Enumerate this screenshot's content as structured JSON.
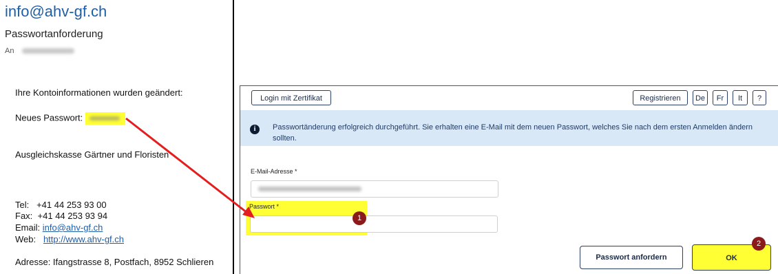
{
  "email": {
    "sender": "info@ahv-gf.ch",
    "subject": "Passwortanforderung",
    "to_label": "An",
    "body_intro": "Ihre Kontoinformationen wurden geändert:",
    "new_password_label": "Neues Passwort:",
    "org_name": "Ausgleichskasse Gärtner und Floristen",
    "tel_label": "Tel:",
    "tel": "+41 44 253 93 00",
    "fax_label": "Fax:",
    "fax": "+41 44 253 93 94",
    "email_label": "Email:",
    "email_link": "info@ahv-gf.ch",
    "web_label": "Web:",
    "web_link": "http://www.ahv-gf.ch",
    "address": "Adresse: Ifangstrasse 8, Postfach, 8952 Schlieren"
  },
  "form": {
    "login_cert": "Login mit Zertifikat",
    "register": "Registrieren",
    "languages": [
      "De",
      "Fr",
      "It"
    ],
    "help": "?",
    "info_icon": "info-icon",
    "info_message": "Passwortänderung erfolgreich durchgeführt. Sie erhalten eine E-Mail mit dem neuen Passwort, welches Sie nach dem ersten Anmelden ändern sollten.",
    "email_field_label": "E-Mail-Adresse *",
    "password_field_label": "Passwort *",
    "request_password": "Passwort anfordern",
    "ok": "OK"
  },
  "annotations": {
    "step1": "1",
    "step2": "2",
    "highlight_color": "#ffff33",
    "arrow_color": "#e41e1e"
  }
}
